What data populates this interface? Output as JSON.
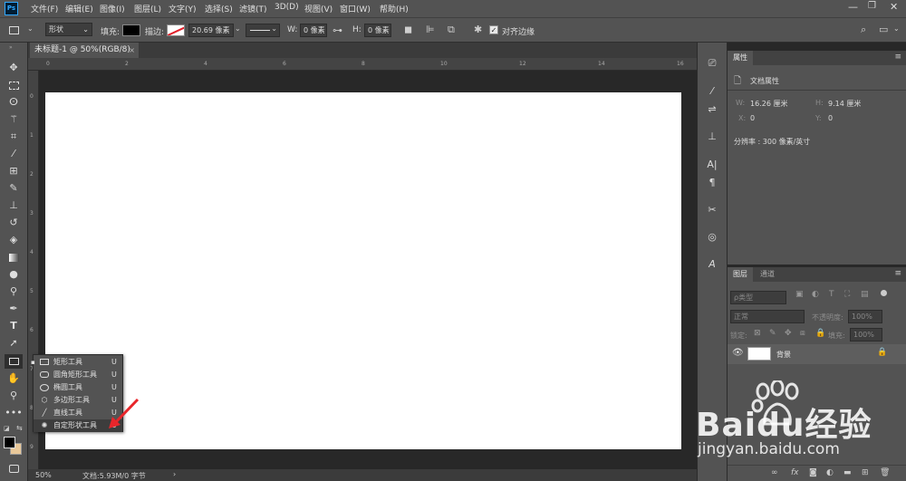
{
  "menubar": {
    "app_icon": "Ps",
    "menus": [
      "文件(F)",
      "编辑(E)",
      "图像(I)",
      "图层(L)",
      "文字(Y)",
      "选择(S)",
      "滤镜(T)",
      "3D(D)",
      "视图(V)",
      "窗口(W)",
      "帮助(H)"
    ],
    "window_controls": [
      "minimize-icon",
      "restore-icon",
      "close-icon"
    ]
  },
  "options": {
    "mode": "形状",
    "fill_label": "填充:",
    "stroke_label": "描边:",
    "stroke_width": "20.69 像素",
    "w_label": "W:",
    "w_value": "0 像素",
    "h_label": "H:",
    "h_value": "0 像素",
    "align_edges_label": "对齐边缘",
    "align_edges_checked": true
  },
  "document": {
    "tab_title": "未标题-1 @ 50%(RGB/8)",
    "canvas_color": "#ffffff",
    "ruler_h_numbers": [
      "0",
      "2",
      "4",
      "6",
      "8",
      "10",
      "12",
      "14",
      "16"
    ],
    "ruler_v_numbers": [
      "0",
      "1",
      "2",
      "3",
      "4",
      "5",
      "6",
      "7",
      "8",
      "9"
    ]
  },
  "statusbar": {
    "zoom": "50%",
    "doc_info": "文档:5.93M/0 字节"
  },
  "tool_flyout": {
    "items": [
      {
        "label": "矩形工具",
        "key": "U",
        "icon": "rectangle-icon",
        "active": true
      },
      {
        "label": "圆角矩形工具",
        "key": "U",
        "icon": "rounded-rectangle-icon",
        "active": false
      },
      {
        "label": "椭圆工具",
        "key": "U",
        "icon": "ellipse-icon",
        "active": false
      },
      {
        "label": "多边形工具",
        "key": "U",
        "icon": "polygon-icon",
        "active": false
      },
      {
        "label": "直线工具",
        "key": "U",
        "icon": "line-icon",
        "active": false
      },
      {
        "label": "自定形状工具",
        "key": "U",
        "icon": "custom-shape-icon",
        "active": false
      }
    ]
  },
  "properties": {
    "tab": "属性",
    "doc_props_label": "文档属性",
    "w_label": "W:",
    "w_value": "16.26 厘米",
    "h_label": "H:",
    "h_value": "9.14 厘米",
    "x_label": "X:",
    "x_value": "0",
    "y_label": "Y:",
    "y_value": "0",
    "resolution": "分辨率 : 300 像素/英寸"
  },
  "layers": {
    "tabs": [
      "图层",
      "通道"
    ],
    "filter_kind": "ρ类型",
    "blend_mode": "正常",
    "opacity_label": "不透明度:",
    "opacity_value": "100%",
    "lock_label": "锁定:",
    "fill_label": "填充:",
    "fill_value": "100%",
    "layer_name": "背景"
  },
  "watermark": {
    "brand_text": "Baidu经验",
    "url": "jingyan.baidu.com"
  },
  "colors": {
    "annotation_arrow": "#e8262b",
    "accent": "#e6a23c"
  }
}
